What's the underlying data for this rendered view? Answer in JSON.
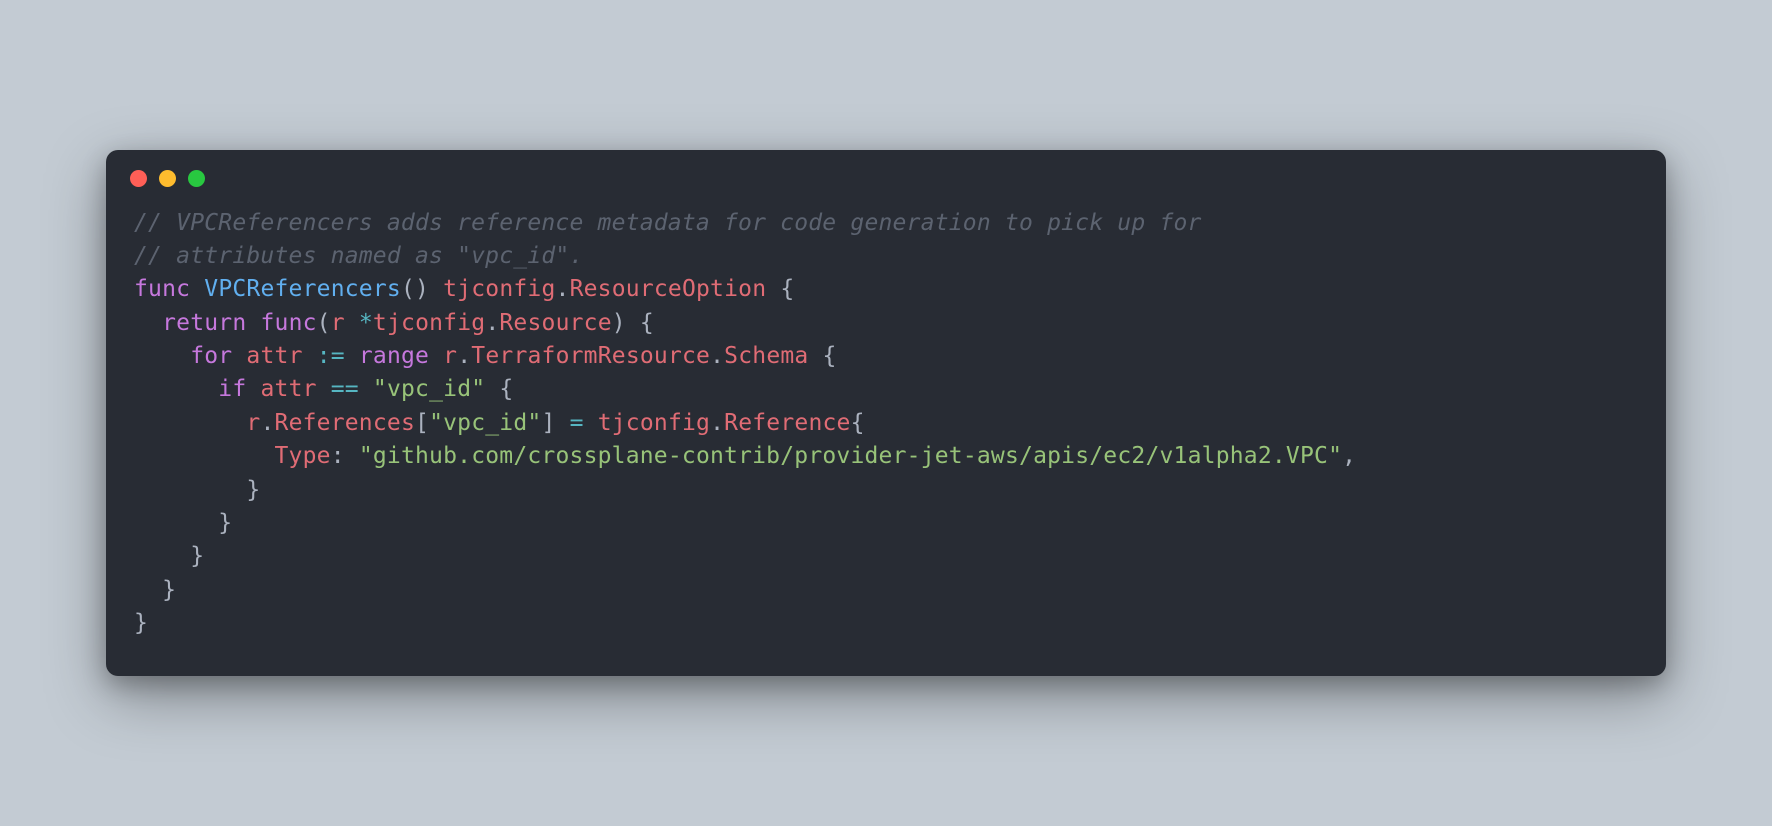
{
  "window": {
    "traffic_lights": [
      "red",
      "yellow",
      "green"
    ]
  },
  "code": {
    "comment1": "// VPCReferencers adds reference metadata for code generation to pick up for",
    "comment2": "// attributes named as \"vpc_id\".",
    "kw_func": "func",
    "fn_name": "VPCReferencers",
    "paren_open": "(",
    "paren_close": ")",
    "ret_pkg": "tjconfig",
    "dot": ".",
    "ret_type": "ResourceOption",
    "brace_open": "{",
    "brace_close": "}",
    "kw_return": "return",
    "kw_func2": "func",
    "param_r": "r",
    "star": "*",
    "param_pkg": "tjconfig",
    "param_type": "Resource",
    "kw_for": "for",
    "attr": "attr",
    "coloneq": ":=",
    "kw_range": "range",
    "r_var": "r",
    "tr": "TerraformResource",
    "schema": "Schema",
    "kw_if": "if",
    "attr2": "attr",
    "eqeq": "==",
    "str_vpcid": "\"vpc_id\"",
    "r_var2": "r",
    "refs": "References",
    "lbracket": "[",
    "rbracket": "]",
    "eq": "=",
    "tjconfig2": "tjconfig",
    "reference": "Reference",
    "type_key": "Type",
    "colon": ":",
    "str_path": "\"github.com/crossplane-contrib/provider-jet-aws/apis/ec2/v1alpha2.VPC\"",
    "comma": ","
  }
}
